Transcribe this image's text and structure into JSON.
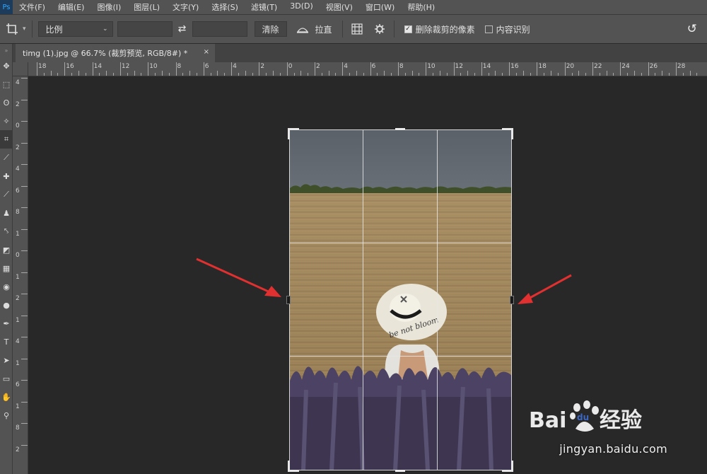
{
  "menubar": {
    "app_icon": "photoshop-logo",
    "items": [
      "文件(F)",
      "编辑(E)",
      "图像(I)",
      "图层(L)",
      "文字(Y)",
      "选择(S)",
      "滤镜(T)",
      "3D(D)",
      "视图(V)",
      "窗口(W)",
      "帮助(H)"
    ]
  },
  "options": {
    "tool_icon": "crop-icon",
    "ratio_select": "比例",
    "width_value": "",
    "height_value": "",
    "swap_icon": "swap-icon",
    "clear_label": "清除",
    "straighten_icon": "level-icon",
    "straighten_label": "拉直",
    "overlay_icon": "grid-overlay-icon",
    "settings_icon": "gear-icon",
    "delete_cropped_label": "删除裁剪的像素",
    "delete_cropped_checked": true,
    "content_aware_label": "内容识别",
    "content_aware_checked": false,
    "reset_icon": "undo-icon"
  },
  "tab": {
    "title": "timg (1).jpg @ 66.7% (裁剪预览, RGB/8#) *",
    "close": "×"
  },
  "ruler": {
    "h_labels": [
      "18",
      "16",
      "14",
      "12",
      "10",
      "8",
      "6",
      "4",
      "2",
      "0",
      "2",
      "4",
      "6",
      "8",
      "10",
      "12",
      "14",
      "16",
      "18",
      "20",
      "22",
      "24",
      "26",
      "28"
    ],
    "v_labels": [
      "4",
      "2",
      "0",
      "2",
      "4",
      "6",
      "8",
      "1",
      "0",
      "1",
      "2",
      "1",
      "4",
      "1",
      "6",
      "1",
      "8",
      "2"
    ]
  },
  "tools": [
    "move-icon",
    "marquee-icon",
    "lasso-icon",
    "magic-wand-icon",
    "crop-icon",
    "eyedropper-icon",
    "healing-icon",
    "brush-icon",
    "stamp-icon",
    "history-brush-icon",
    "eraser-icon",
    "gradient-icon",
    "blur-icon",
    "dodge-icon",
    "pen-icon",
    "type-icon",
    "path-select-icon",
    "rectangle-icon",
    "hand-icon",
    "zoom-icon"
  ],
  "watermark": {
    "logo": "Bai du 经验",
    "url": "jingyan.baidu.com"
  },
  "colors": {
    "panel": "#535353",
    "canvas": "#282828",
    "arrow": "#e03030"
  }
}
